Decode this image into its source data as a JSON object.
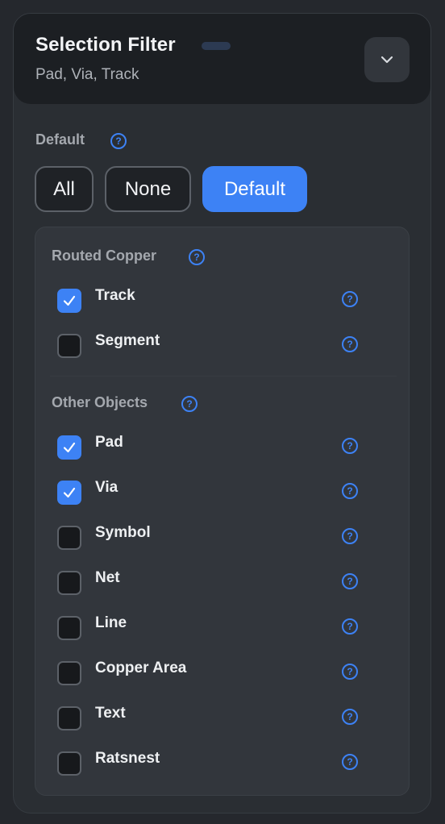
{
  "header": {
    "title": "Selection Filter",
    "subtitle": "Pad, Via, Track",
    "collapse_icon": "chevron-down-icon"
  },
  "preset": {
    "label": "Default",
    "help": "?",
    "buttons": [
      {
        "label": "All",
        "active": false
      },
      {
        "label": "None",
        "active": false
      },
      {
        "label": "Default",
        "active": true
      }
    ]
  },
  "groups": [
    {
      "label": "Routed Copper",
      "help": "?",
      "items": [
        {
          "label": "Track",
          "checked": true,
          "help": "?"
        },
        {
          "label": "Segment",
          "checked": false,
          "help": "?"
        }
      ]
    },
    {
      "label": "Other Objects",
      "help": "?",
      "items": [
        {
          "label": "Pad",
          "checked": true,
          "help": "?"
        },
        {
          "label": "Via",
          "checked": true,
          "help": "?"
        },
        {
          "label": "Symbol",
          "checked": false,
          "help": "?"
        },
        {
          "label": "Net",
          "checked": false,
          "help": "?"
        },
        {
          "label": "Line",
          "checked": false,
          "help": "?"
        },
        {
          "label": "Copper Area",
          "checked": false,
          "help": "?"
        },
        {
          "label": "Text",
          "checked": false,
          "help": "?"
        },
        {
          "label": "Ratsnest",
          "checked": false,
          "help": "?"
        }
      ]
    }
  ],
  "colors": {
    "accent": "#3d82f5",
    "background": "#25282d",
    "panel": "#2a2e33",
    "header": "#1c1f23",
    "filter_box": "#32363c"
  }
}
